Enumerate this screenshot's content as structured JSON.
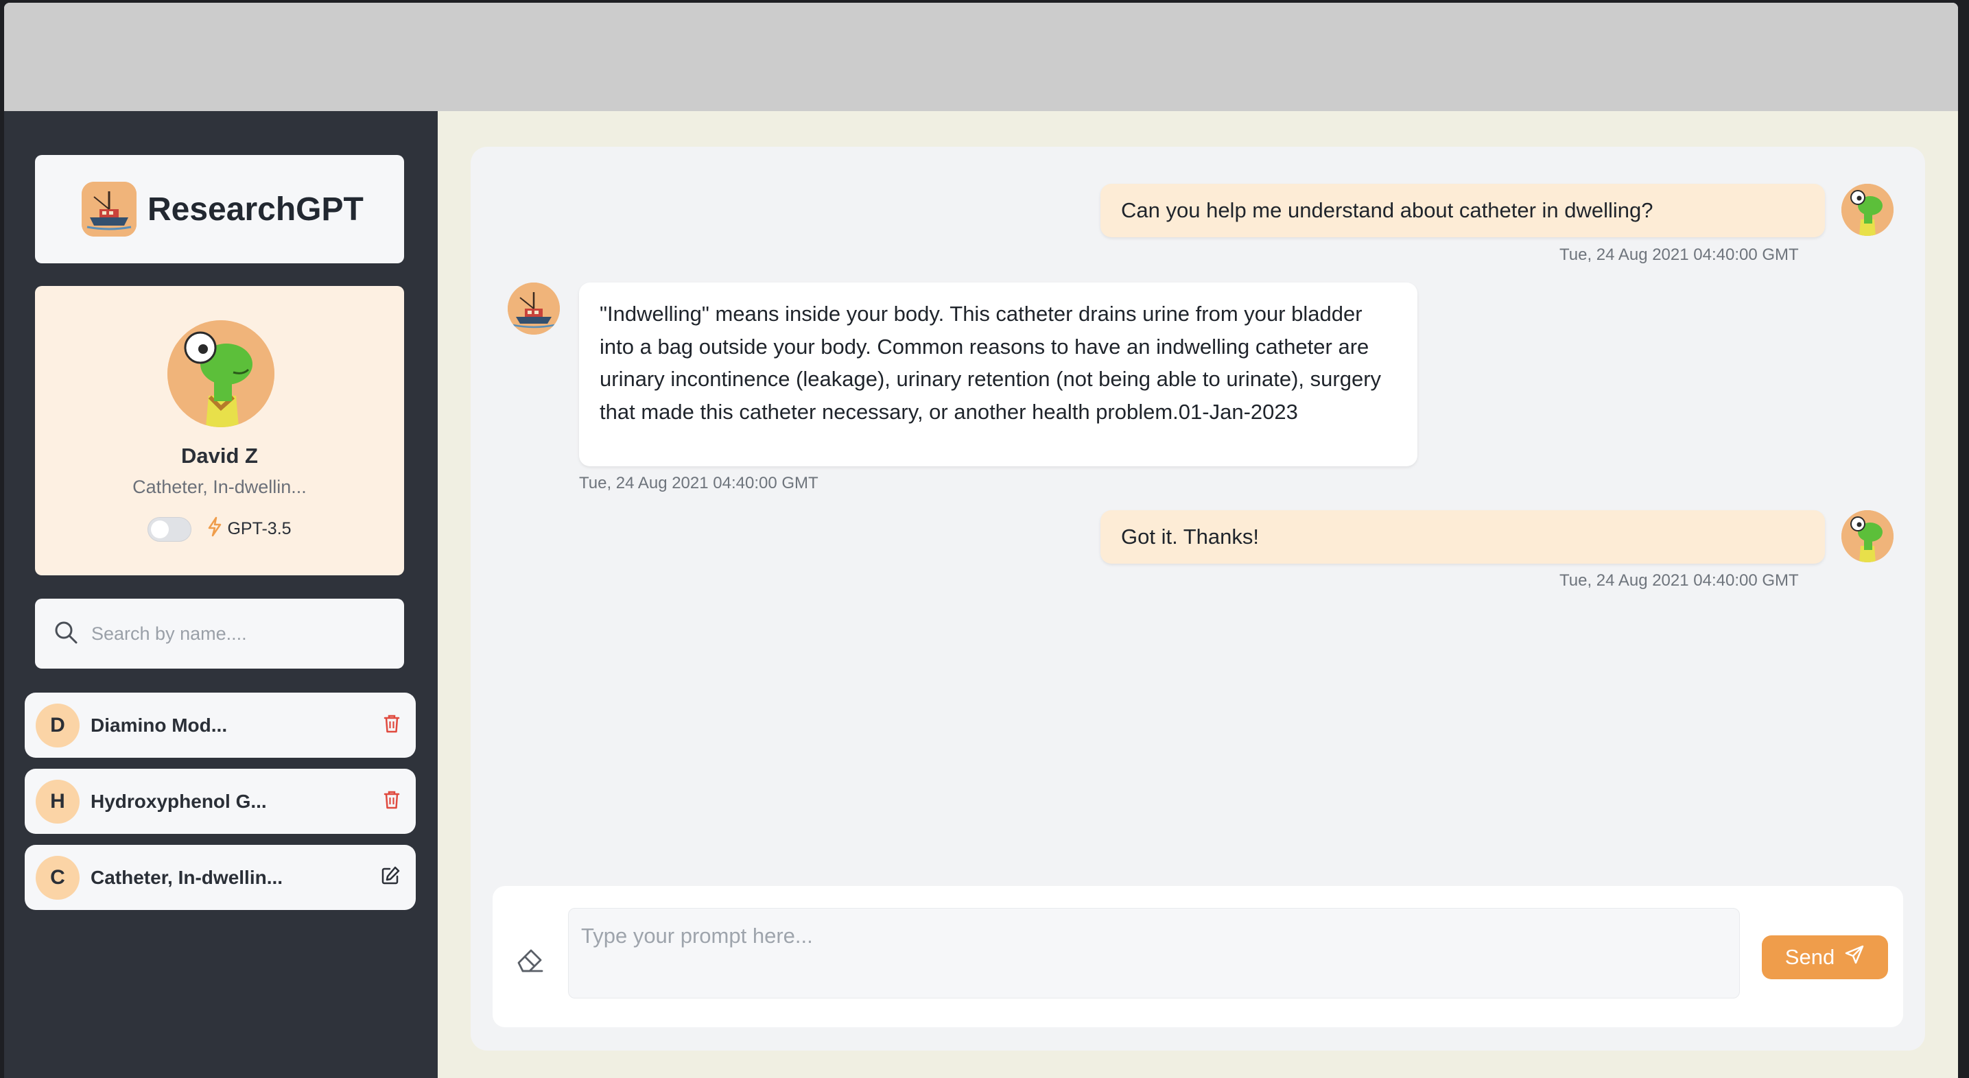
{
  "app": {
    "title": "ResearchGPT"
  },
  "profile": {
    "name": "David Z",
    "subtitle": "Catheter, In-dwellin...",
    "model_label": "GPT-3.5",
    "toggle_on": false
  },
  "search": {
    "placeholder": "Search by name...."
  },
  "chats": [
    {
      "letter": "D",
      "label": "Diamino Mod...",
      "action_icon": "trash-icon"
    },
    {
      "letter": "H",
      "label": "Hydroxyphenol G...",
      "action_icon": "trash-icon"
    },
    {
      "letter": "C",
      "label": "Catheter, In-dwellin...",
      "action_icon": "edit-icon"
    }
  ],
  "messages": [
    {
      "role": "user",
      "text": "Can you help me understand about catheter in dwelling?",
      "time": "Tue, 24 Aug 2021 04:40:00 GMT"
    },
    {
      "role": "assistant",
      "text": "\"Indwelling\" means inside your body. This catheter drains urine from your bladder into a bag outside your body. Common reasons to have an indwelling catheter are urinary incontinence (leakage), urinary retention (not being able to urinate), surgery that made this catheter necessary, or another health problem.01-Jan-2023",
      "time": "Tue, 24 Aug 2021 04:40:00 GMT"
    },
    {
      "role": "user",
      "text": "Got it. Thanks!",
      "time": "Tue, 24 Aug 2021 04:40:00 GMT"
    }
  ],
  "composer": {
    "placeholder": "Type your prompt here...",
    "send_label": "Send"
  },
  "colors": {
    "accent": "#ef9d4b",
    "sidebar": "#2f333b",
    "user_bubble": "#fdecd6",
    "delete": "#e04a3f"
  }
}
